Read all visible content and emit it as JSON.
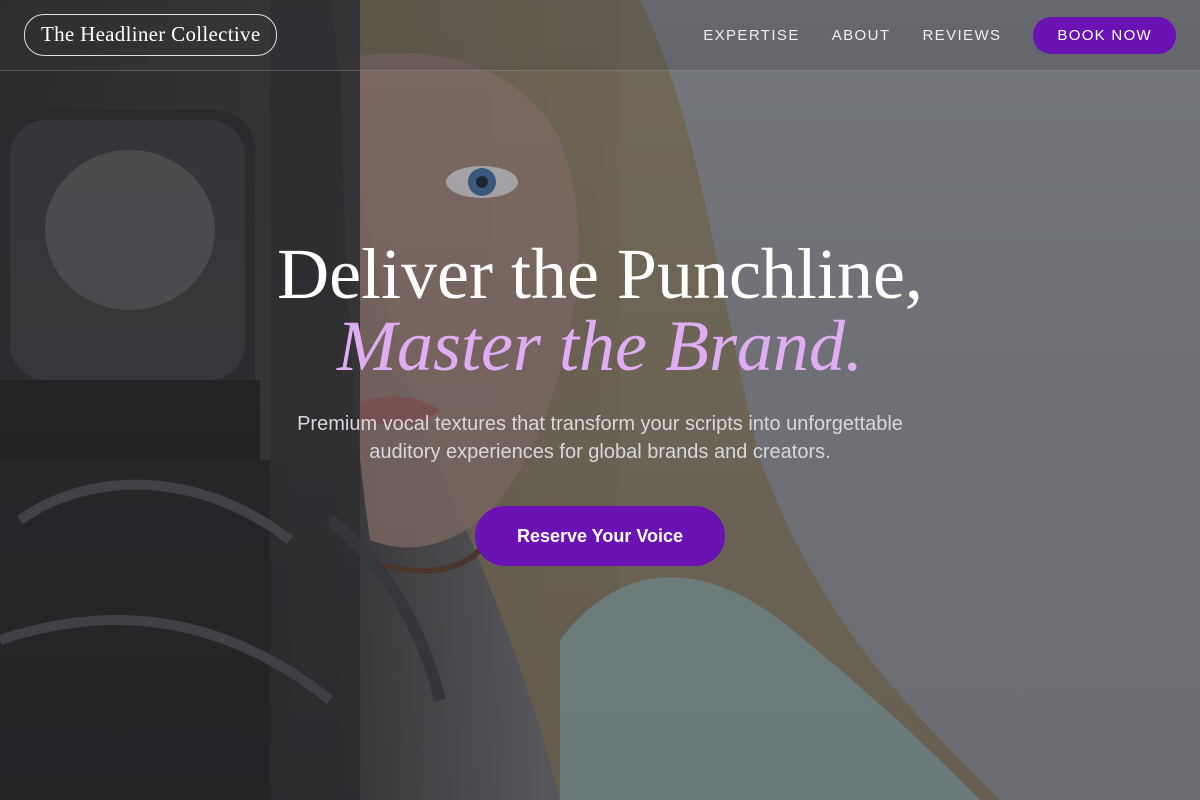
{
  "header": {
    "brand": "The Headliner Collective",
    "nav": [
      {
        "label": "EXPERTISE"
      },
      {
        "label": "ABOUT"
      },
      {
        "label": "REVIEWS"
      }
    ],
    "book_label": "BOOK NOW"
  },
  "hero": {
    "headline_line1": "Deliver the Punchline,",
    "headline_line2": "Master the Brand.",
    "subtitle": "Premium vocal textures that transform your scripts into unforgettable auditory experiences for global brands and creators.",
    "cta_label": "Reserve Your Voice",
    "background_image": "woman-with-studio-microphone-photo"
  },
  "colors": {
    "accent": "#6a12b3",
    "headline_accent": "#e0adf2",
    "text_primary": "#ffffff"
  }
}
